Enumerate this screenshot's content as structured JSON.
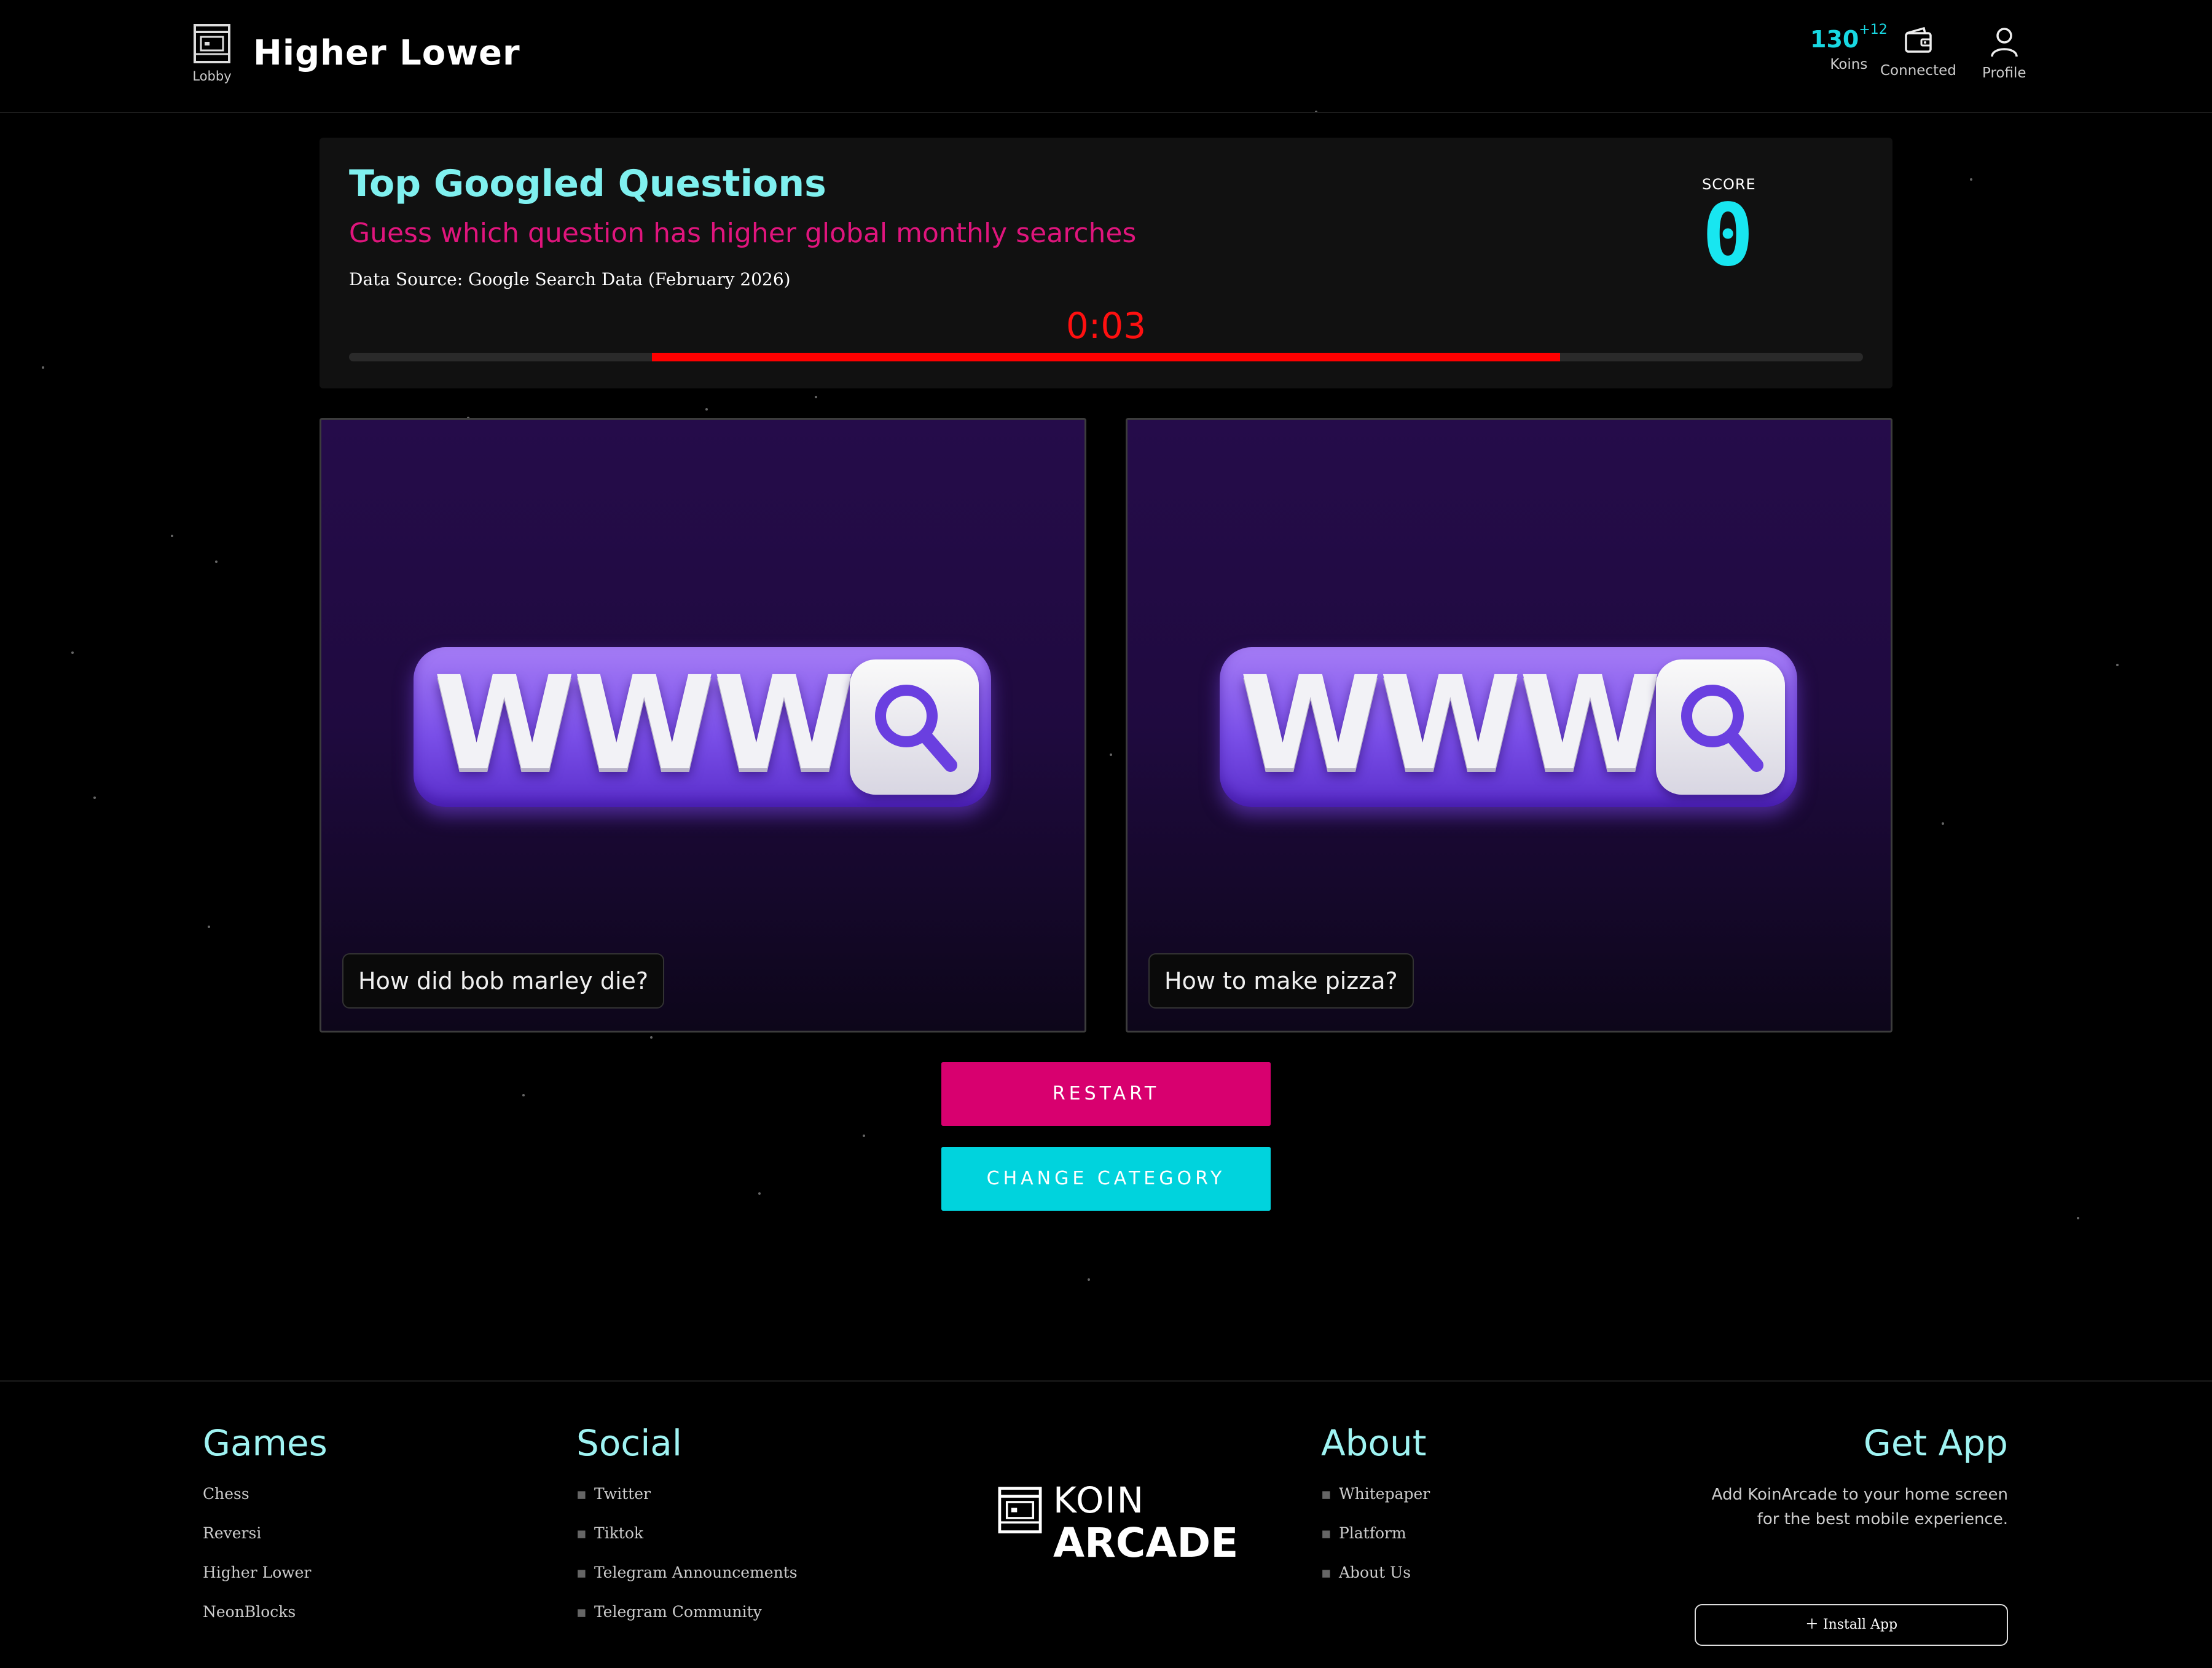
{
  "header": {
    "lobby_label": "Lobby",
    "title": "Higher Lower",
    "koins_value": "130",
    "koins_delta": "+12",
    "koins_label": "Koins",
    "wallet_label": "Connected",
    "profile_label": "Profile",
    "accent_color": "#18d8e2"
  },
  "game": {
    "category_title": "Top Googled Questions",
    "subtitle": "Guess which question has higher global monthly searches",
    "data_source": "Data Source: Google Search Data (February 2026)",
    "score_label": "SCORE",
    "score_value": "0",
    "timer_text": "0:03",
    "timer_bar_start_fraction": 0.2,
    "timer_bar_end_fraction": 0.8,
    "timer_color": "#ff0000"
  },
  "cards": [
    {
      "image_text": "WWW",
      "icon": "magnifier-icon",
      "question": "How did bob marley die?"
    },
    {
      "image_text": "WWW",
      "icon": "magnifier-icon",
      "question": "How to make pizza?"
    }
  ],
  "buttons": {
    "restart": "RESTART",
    "change_category": "CHANGE CATEGORY",
    "restart_color": "#d8006f",
    "change_color": "#00d3dd"
  },
  "footer": {
    "games": {
      "heading": "Games",
      "links": [
        "Chess",
        "Reversi",
        "Higher Lower",
        "NeonBlocks"
      ]
    },
    "social": {
      "heading": "Social",
      "links": [
        "Twitter",
        "Tiktok",
        "Telegram Announcements",
        "Telegram Community"
      ]
    },
    "logo": {
      "line1": "KOIN",
      "line2": "ARCADE"
    },
    "about": {
      "heading": "About",
      "links": [
        "Whitepaper",
        "Platform",
        "About Us"
      ]
    },
    "get_app": {
      "heading": "Get App",
      "desc_line1": "Add KoinArcade to your home screen",
      "desc_line2": "for the best mobile experience.",
      "install_label": "Install App"
    }
  }
}
